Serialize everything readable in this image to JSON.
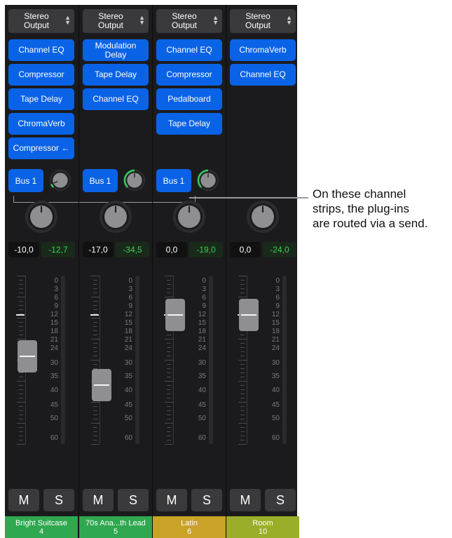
{
  "strips": [
    {
      "output": "Stereo\nOutput",
      "plugins": [
        "Channel EQ",
        "Compressor",
        "Tape Delay",
        "ChromaVerb",
        "Compressor ←"
      ],
      "send": {
        "label": "Bus 1",
        "level": 0.08
      },
      "volume": "-10,0",
      "peak": "-12,7",
      "fader_db": 27,
      "mute": "M",
      "solo": "S",
      "name": "Bright Suitcase",
      "number": "4",
      "color": "#2fa84f"
    },
    {
      "output": "Stereo\nOutput",
      "plugins": [
        "Modulation\nDelay",
        "Tape Delay",
        "Channel EQ"
      ],
      "send": {
        "label": "Bus 1",
        "level": 0.5
      },
      "volume": "-17,0",
      "peak": "-34,5",
      "fader_db": 38,
      "mute": "M",
      "solo": "S",
      "name": "70s Ana...th Lead",
      "number": "5",
      "color": "#2fa84f"
    },
    {
      "output": "Stereo\nOutput",
      "plugins": [
        "Channel EQ",
        "Compressor",
        "Pedalboard",
        "Tape Delay"
      ],
      "send": {
        "label": "Bus 1",
        "level": 0.5
      },
      "volume": "0,0",
      "peak": "-19,0",
      "fader_db": 12,
      "mute": "M",
      "solo": "S",
      "name": "Latin",
      "number": "6",
      "color": "#c9a227"
    },
    {
      "output": "Stereo\nOutput",
      "plugins": [
        "ChromaVerb",
        "Channel EQ"
      ],
      "send": null,
      "volume": "0,0",
      "peak": "-24,0",
      "fader_db": 12,
      "mute": "M",
      "solo": "S",
      "name": "Room",
      "number": "10",
      "color": "#9aae2a"
    }
  ],
  "scale_labels": [
    "0",
    "3",
    "6",
    "9",
    "12",
    "15",
    "18",
    "21",
    "24",
    "30",
    "35",
    "40",
    "45",
    "50",
    "60"
  ],
  "callout": {
    "line1": "On these channel",
    "line2": "strips, the plug-ins",
    "line3": "are routed via a send."
  }
}
